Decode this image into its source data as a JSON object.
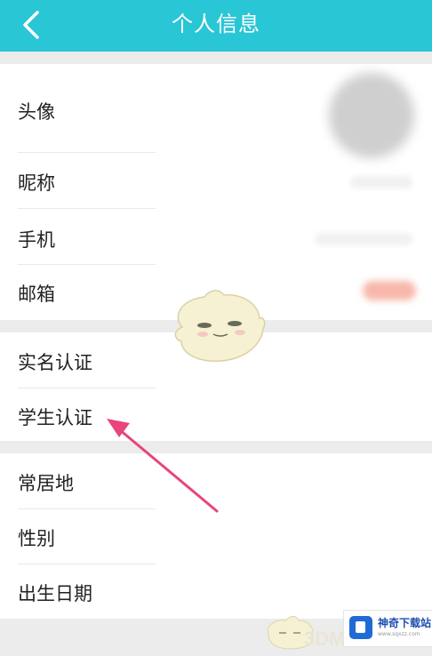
{
  "header": {
    "title": "个人信息",
    "back_icon": "chevron-left-icon",
    "color": "#29c6d6"
  },
  "rows": {
    "avatar": "头像",
    "nickname": "昵称",
    "phone": "手机",
    "email": "邮箱",
    "real_name": "实名认证",
    "student": "学生认证",
    "residence": "常居地",
    "gender": "性别",
    "birthday": "出生日期"
  },
  "watermark": {
    "site": "神奇下载站",
    "url": "www.sqxzz.com",
    "text_3d": "3DM"
  }
}
